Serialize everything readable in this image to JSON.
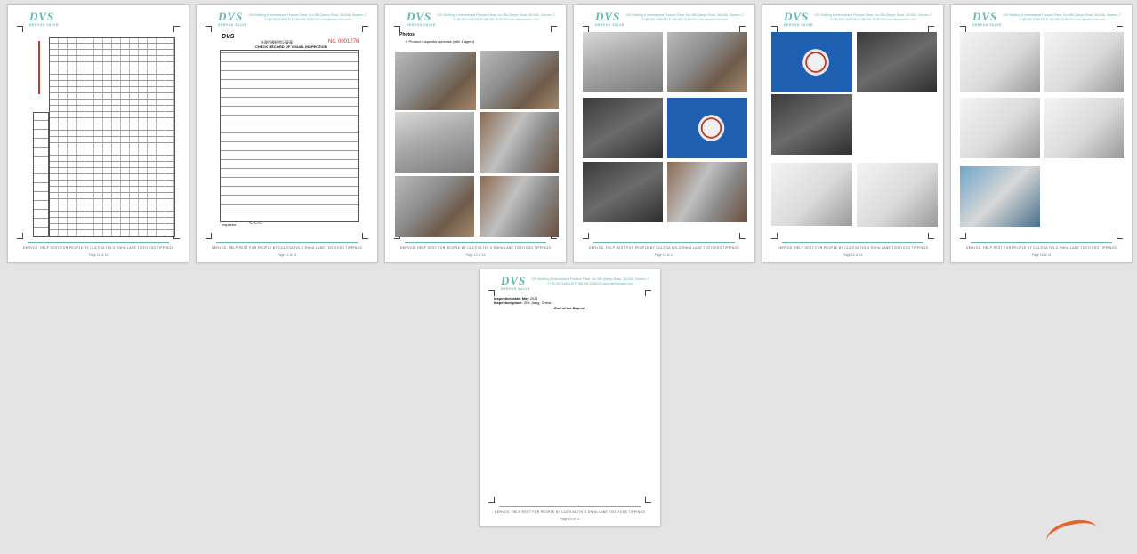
{
  "header": {
    "logo": "DVS",
    "logo_sub": "DERVOS VALVE",
    "address": "10G Building A International Finance Place, No.386 Qianpu Road, 361008, Xiamen, China.",
    "contact": "T:+86 592 5185226  F:+86 592 5185225  www.dervosvalve.com"
  },
  "footer": {
    "slogan": "DERVOS, HELP REST FOR PEOPLE BY CULTIVA TIN G ENHA LANE TISTH ESS TIPPINGS"
  },
  "pages": [
    {
      "page_label": "Page 11 of 14"
    },
    {
      "page_label": "Page 12 of 14",
      "form_title_cn": "外观目视检验记录表",
      "form_title": "CHECK RECORD OF VISUAL INSPECTION",
      "report_no": "No. 0001276",
      "rows": [
        "1",
        "2",
        "3",
        "4",
        "5",
        "6",
        "7",
        "8",
        "9",
        "10",
        "11",
        "12",
        "13",
        "14",
        "15"
      ],
      "sig_label": "Inspector"
    },
    {
      "page_label": "Page 13 of 14",
      "section": "Photos",
      "bullet": "Product Inspection process (with 1 agent)"
    },
    {
      "page_label": "Page 14 of 14"
    },
    {
      "page_label": "Page 15 of 14"
    },
    {
      "page_label": "Page 16 of 14"
    },
    {
      "page_label": "Page 16 of 14",
      "inspection_date_label": "Inspection date: May",
      "inspection_date_value": "2021",
      "inspection_place_label": "Inspection place:",
      "inspection_place_value": "Zhe Jiang, China",
      "end": "—End of the Report—"
    }
  ]
}
